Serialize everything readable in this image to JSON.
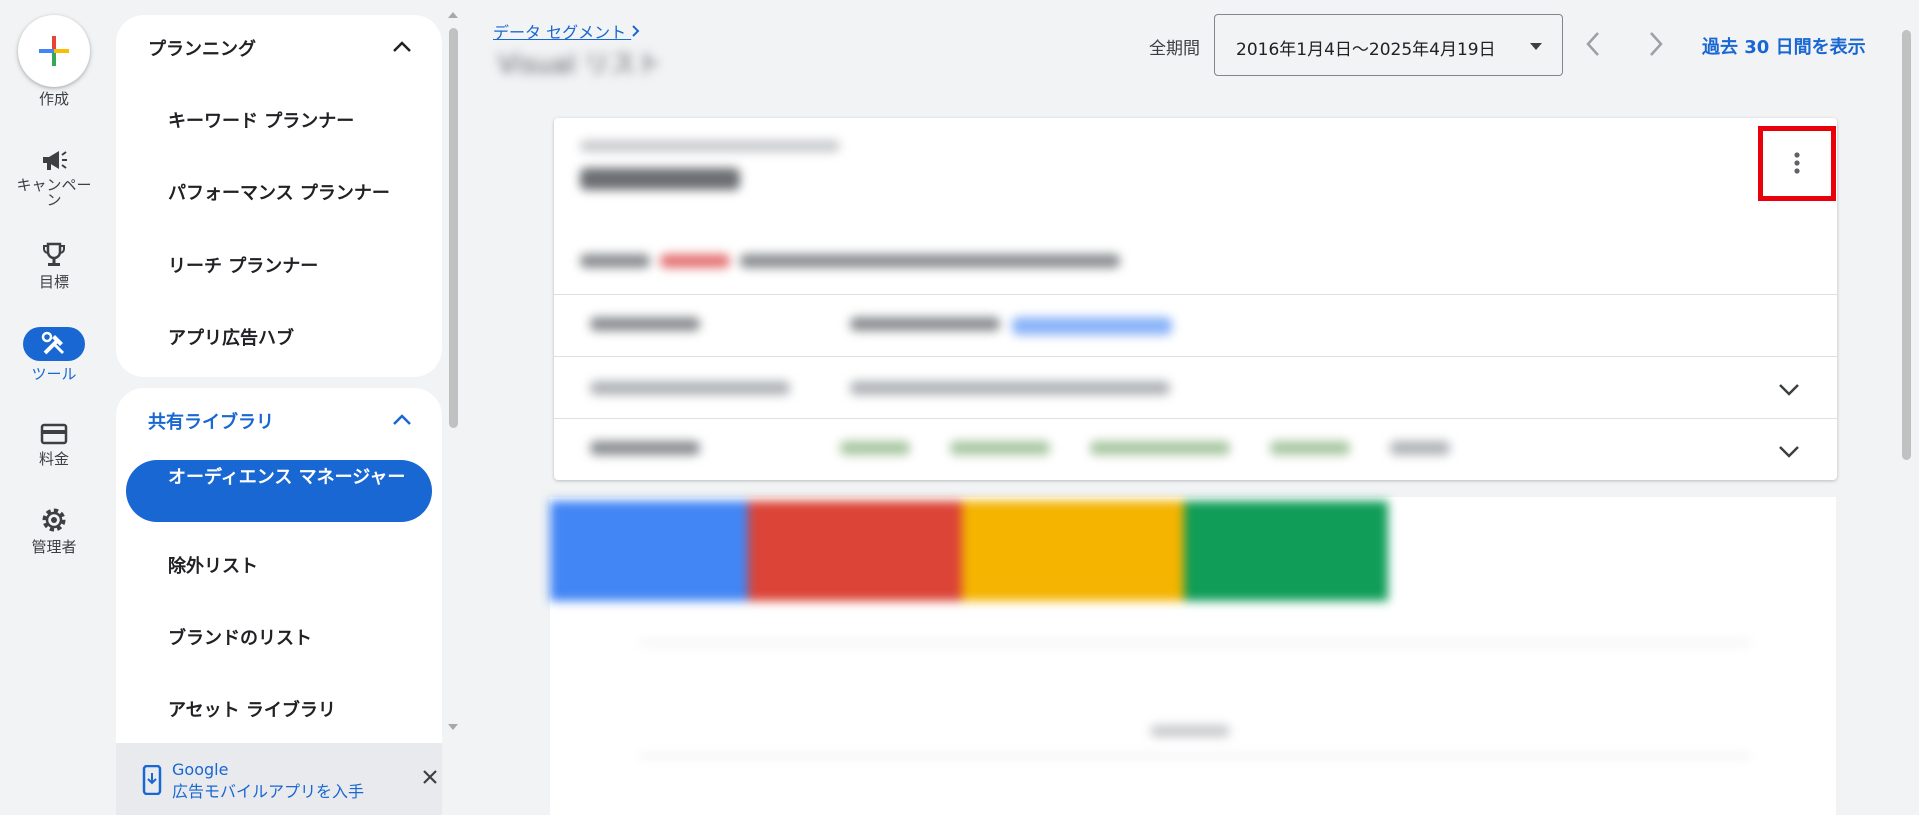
{
  "rail": {
    "create_label": "作成",
    "items": [
      {
        "label": "キャンペーン",
        "icon": "megaphone-icon"
      },
      {
        "label": "目標",
        "icon": "trophy-icon"
      },
      {
        "label": "ツール",
        "icon": "tools-icon"
      },
      {
        "label": "料金",
        "icon": "credit-card-icon"
      },
      {
        "label": "管理者",
        "icon": "gear-icon"
      }
    ]
  },
  "nav": {
    "planning": {
      "heading": "プランニング",
      "items": [
        "キーワード プランナー",
        "パフォーマンス プランナー",
        "リーチ プランナー",
        "アプリ広告ハブ"
      ]
    },
    "shared_library": {
      "heading": "共有ライブラリ",
      "active_item": "オーディエンス マネージャー",
      "items": [
        "除外リスト",
        "ブランドのリスト",
        "アセット ライブラリ"
      ]
    },
    "promo": {
      "line1": "Google",
      "line2": "広告モバイルアプリを入手"
    }
  },
  "header": {
    "breadcrumb": "データ セグメント",
    "title_blurred": "Visual リスト",
    "date_label": "全期間",
    "date_range": "2016年1月4日〜2025年4月19日",
    "last30_link": "過去 30 日間を表示"
  },
  "colors": {
    "accent": "#1967d2",
    "highlight": "#e8000a",
    "tile_blue": "#4285f4",
    "tile_red": "#db4437",
    "tile_yellow": "#f4b400",
    "tile_green": "#0f9d58"
  }
}
